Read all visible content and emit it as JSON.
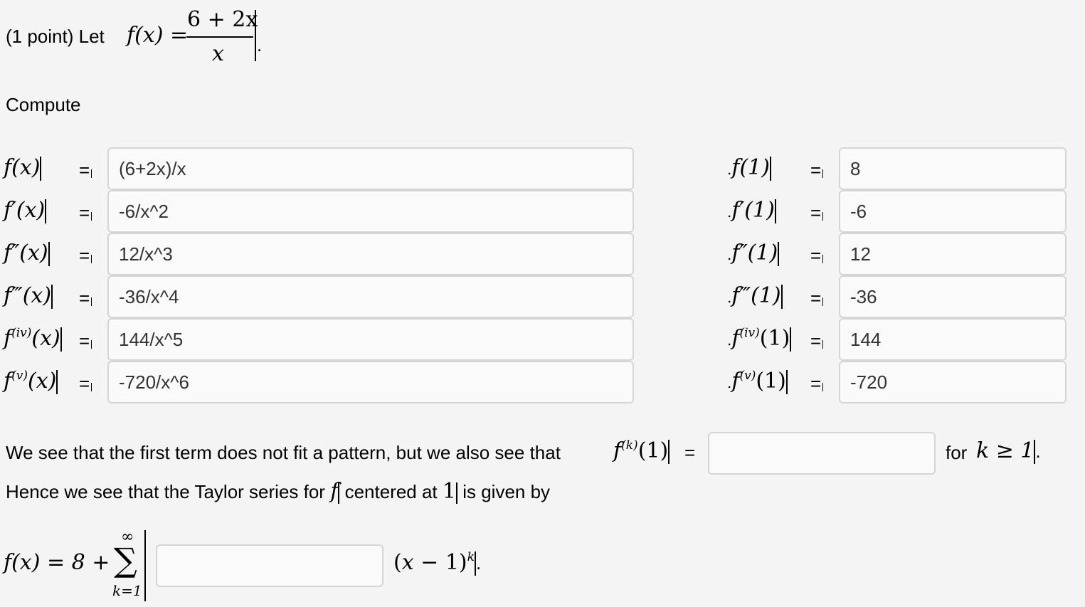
{
  "problem": {
    "points_label": "(1 point) Let",
    "function_name": "f(x) =",
    "numerator": "6 + 2x",
    "denominator": "x",
    "end_period": "."
  },
  "compute_label": "Compute",
  "rows": [
    {
      "lhs_func": "f(x)",
      "lhs_val": "f(1)",
      "func_answer": "(6+2x)/x",
      "val_answer": "8"
    },
    {
      "lhs_func": "f′(x)",
      "lhs_val": "f′(1)",
      "func_answer": "-6/x^2",
      "val_answer": "-6"
    },
    {
      "lhs_func": "f″(x)",
      "lhs_val": "f″(1)",
      "func_answer": "12/x^3",
      "val_answer": "12"
    },
    {
      "lhs_func": "f‴(x)",
      "lhs_val": "f‴(1)",
      "func_answer": "-36/x^4",
      "val_answer": "-36"
    },
    {
      "lhs_func_base": "f",
      "lhs_func_sup": "(iv)",
      "lhs_func_arg": "(x)",
      "lhs_val_arg": "(1)",
      "func_answer": "144/x^5",
      "val_answer": "144"
    },
    {
      "lhs_func_base": "f",
      "lhs_func_sup": "(v)",
      "lhs_func_arg": "(x)",
      "lhs_val_arg": "(1)",
      "func_answer": "-720/x^6",
      "val_answer": "-720"
    }
  ],
  "equals": "=",
  "pattern": {
    "sentence": "We see that the first term does not fit a pattern, but we also see that",
    "fk_base": "f",
    "fk_sup": "(k)",
    "fk_arg": "(1)",
    "equals": "=",
    "answer": "",
    "for_label": "for",
    "condition": "k ≥ 1",
    "period": "."
  },
  "taylor": {
    "intro_prefix": "Hence we see that the Taylor series for",
    "intro_f": "f",
    "intro_middle": "centered at",
    "intro_center": "1",
    "intro_suffix": "is given by",
    "lhs": "f(x) = 8 +",
    "sum_symbol": "∑",
    "sum_upper": "∞",
    "sum_lower": "k=1",
    "answer": "",
    "term": "(x − 1)",
    "term_exp": "k",
    "period": "."
  }
}
